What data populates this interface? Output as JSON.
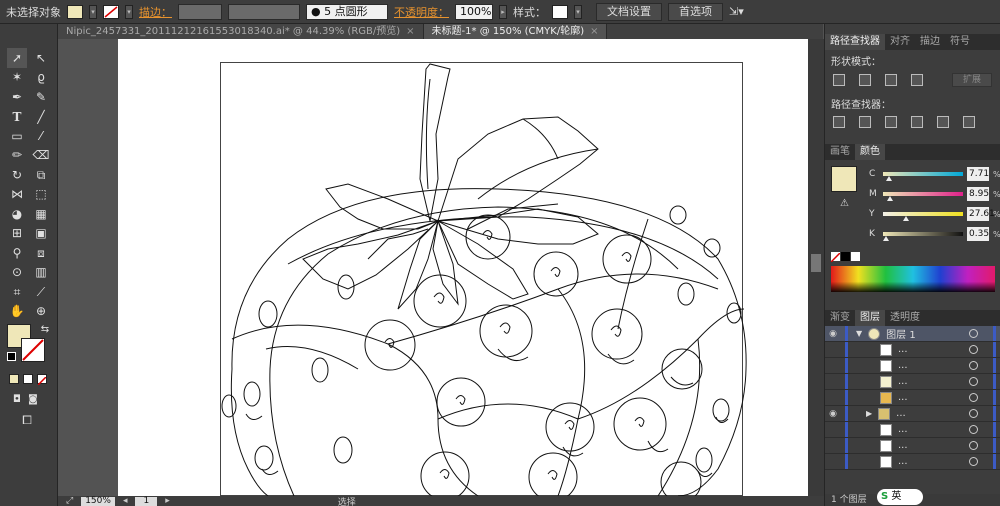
{
  "control_bar": {
    "selection_label": "未选择对象",
    "stroke_label": "描边：",
    "brush_label": "5 点圆形",
    "opacity_label": "不透明度：",
    "opacity_value": "100%",
    "style_label": "样式：",
    "doc_setup": "文档设置",
    "preferences": "首选项"
  },
  "tabs": [
    {
      "label": "Nipic_2457331_20111212161553018340.ai* @ 44.39% (RGB/预览)",
      "close": "×"
    },
    {
      "label": "未标题-1* @ 150% (CMYK/轮廓)",
      "close": "×"
    }
  ],
  "status": {
    "zoom": "150%",
    "page": "1",
    "mode": "选择"
  },
  "pathfinder": {
    "tabs": [
      "路径查找器",
      "对齐",
      "描边",
      "符号"
    ],
    "shape_modes": "形状模式：",
    "expand": "扩展",
    "pathfinders": "路径查找器："
  },
  "color": {
    "tabs": [
      "画笔",
      "颜色"
    ],
    "fill_hex": "#efe7b8",
    "channels": [
      {
        "key": "C",
        "value": "7.71",
        "fraction": 0.08
      },
      {
        "key": "M",
        "value": "8.95",
        "fraction": 0.09
      },
      {
        "key": "Y",
        "value": "27.61",
        "fraction": 0.28
      },
      {
        "key": "K",
        "value": "0.35",
        "fraction": 0.0
      }
    ],
    "percent": "%"
  },
  "layers": {
    "tabs": [
      "渐变",
      "图层",
      "透明度"
    ],
    "top_layer": "图层 1",
    "sublayer": "...",
    "count": "1 个图层"
  },
  "taskbar": {
    "ime": "英"
  }
}
